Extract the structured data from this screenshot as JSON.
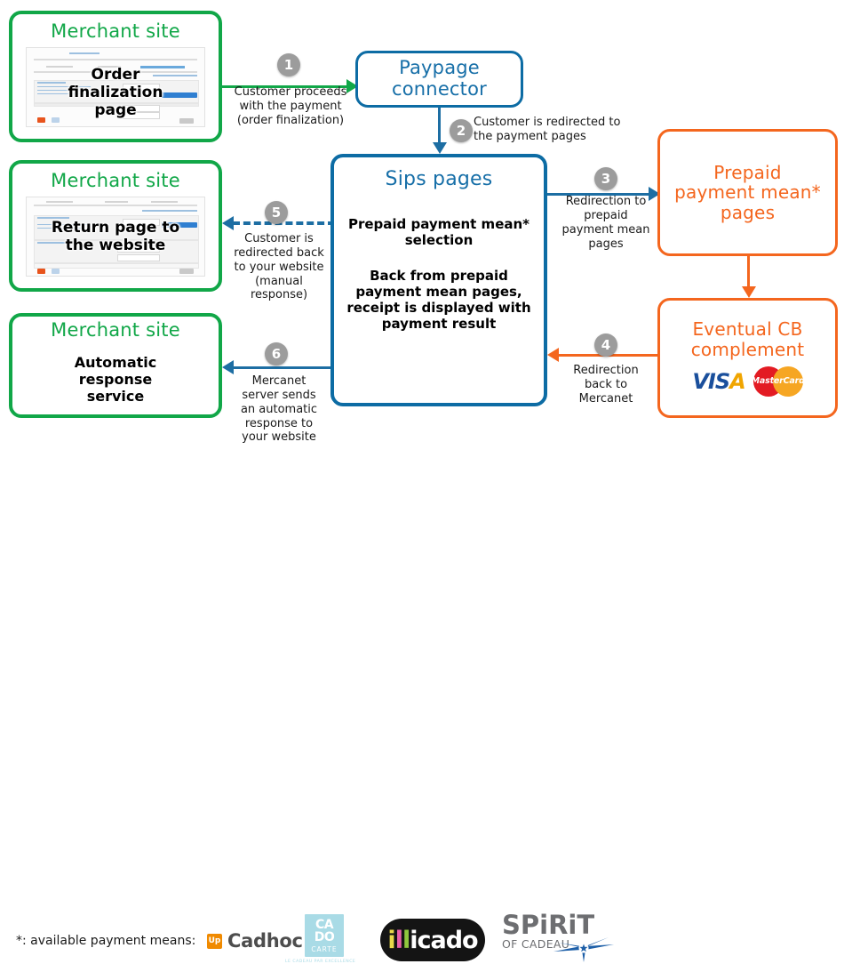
{
  "nodes": {
    "merchant_order": {
      "title": "Merchant site",
      "label": "Order\nfinalization\npage"
    },
    "merchant_return": {
      "title": "Merchant site",
      "label": "Return page to\nthe website"
    },
    "merchant_auto": {
      "title": "Merchant site",
      "label": "Automatic\nresponse\nservice"
    },
    "paypage": {
      "title": "Paypage\nconnector"
    },
    "sips": {
      "title": "Sips pages",
      "body1": "Prepaid payment mean*\nselection",
      "body2": "Back from prepaid\npayment mean pages,\nreceipt is displayed with\npayment result"
    },
    "prepaid": {
      "title": "Prepaid\npayment mean*\npages"
    },
    "eventual": {
      "title": "Eventual CB\ncomplement",
      "cards": [
        "VISA",
        "MasterCard"
      ]
    }
  },
  "steps": [
    {
      "num": "1",
      "caption": "Customer proceeds\nwith the payment\n(order finalization)"
    },
    {
      "num": "2",
      "caption": "Customer is redirected to\nthe payment pages"
    },
    {
      "num": "3",
      "caption": "Redirection to\nprepaid\npayment mean\npages"
    },
    {
      "num": "4",
      "caption": "Redirection\nback to\nMercanet"
    },
    {
      "num": "5",
      "caption": "Customer is\nredirected back\nto your website\n(manual\nresponse)"
    },
    {
      "num": "6",
      "caption": "Mercanet\nserver sends\nan automatic\nresponse to\nyour website"
    }
  ],
  "footer": {
    "label": "*: available payment means:",
    "logos": {
      "cadhoc": {
        "badge": "Up",
        "word": "Cadhoc"
      },
      "cado": {
        "line1": "CA",
        "line2": "DO",
        "line3": "CARTE",
        "tagline": "LE CADEAU PAR EXCELLENCE"
      },
      "illicado": {
        "p1": "i",
        "p2": "l",
        "p3": "l",
        "p4": "icado"
      },
      "spirit": {
        "line1": "SPiRiT",
        "line2": "OF CADEAU"
      }
    }
  },
  "colors": {
    "green": "#11a748",
    "blue": "#0d6ca4",
    "orange": "#f4661e",
    "step_grey": "#9c9c9c"
  }
}
